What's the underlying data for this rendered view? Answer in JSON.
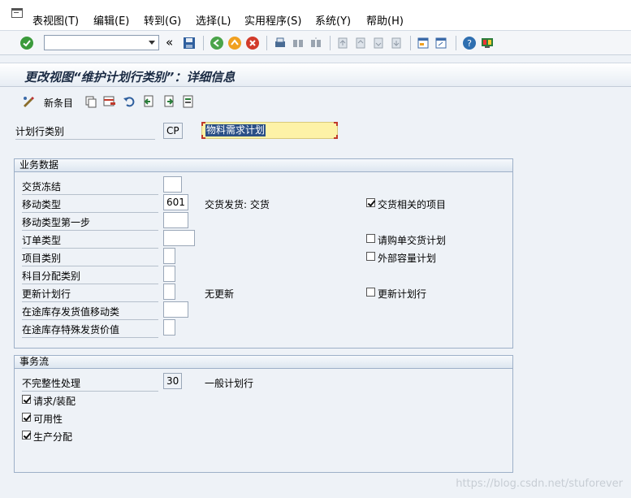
{
  "menu": {
    "items": [
      "表视图(T)",
      "编辑(E)",
      "转到(G)",
      "选择(L)",
      "实用程序(S)",
      "系统(Y)",
      "帮助(H)"
    ]
  },
  "toolbar": {
    "command_value": "",
    "collapse_label": "«"
  },
  "title": "更改视图“维护计划行类别”：详细信息",
  "app_toolbar": {
    "new_entries_label": "新条目"
  },
  "header": {
    "category_label": "计划行类别",
    "category_value": "CP",
    "description_value": "物料需求计划"
  },
  "business_group": {
    "title": "业务数据",
    "rows": [
      {
        "label": "交货冻结",
        "value": ""
      },
      {
        "label": "移动类型",
        "value": "601",
        "desc": "交货发货: 交货"
      },
      {
        "label": "移动类型第一步",
        "value": ""
      },
      {
        "label": "订单类型",
        "value": ""
      },
      {
        "label": "项目类别",
        "value": ""
      },
      {
        "label": "科目分配类别",
        "value": ""
      },
      {
        "label": "更新计划行",
        "value": "",
        "desc": "无更新"
      },
      {
        "label": "在途库存发货值移动类",
        "value": ""
      },
      {
        "label": "在途库存特殊发货价值",
        "value": ""
      }
    ],
    "checkboxes": [
      {
        "label": "交货相关的项目",
        "checked": true
      },
      {
        "label": "请购单交货计划",
        "checked": false
      },
      {
        "label": "外部容量计划",
        "checked": false
      },
      {
        "label": "更新计划行",
        "checked": false
      }
    ]
  },
  "transaction_group": {
    "title": "事务流",
    "incompletion_label": "不完整性处理",
    "incompletion_value": "30",
    "incompletion_desc": "一般计划行",
    "checkboxes": [
      {
        "label": "请求/装配",
        "checked": true
      },
      {
        "label": "可用性",
        "checked": true
      },
      {
        "label": "生产分配",
        "checked": true
      }
    ]
  },
  "watermark": "https://blog.csdn.net/stuforever",
  "colors": {
    "background": "#eef2f7",
    "accent_green": "#3b9a3b",
    "highlight_field": "#fdf2a7",
    "selection": "#2a4f86"
  }
}
